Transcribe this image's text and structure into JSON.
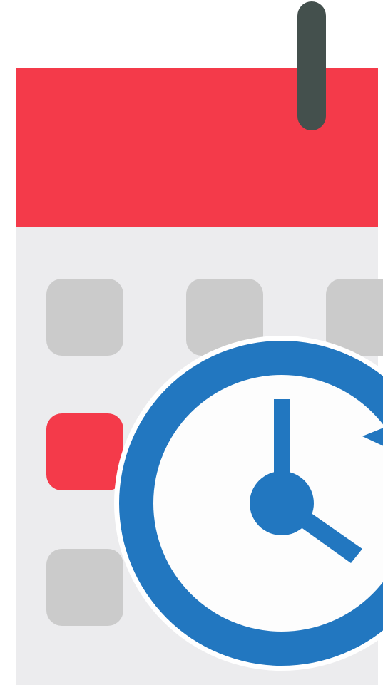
{
  "icon": {
    "subject": "calendar-with-clock",
    "colors": {
      "background": "#ffffff",
      "header": "#f43a4a",
      "body": "#ececee",
      "ring": "#44504d",
      "day_inactive": "#cbcbcb",
      "day_highlight": "#f43a4a",
      "clock_rim": "#2277c0",
      "clock_outline": "#ffffff",
      "clock_face": "#fdfdfd",
      "clock_hands": "#2277c0"
    },
    "day_grid": {
      "rows": 3,
      "highlighted": {
        "row": 2,
        "column": 1
      }
    },
    "icon_names": [
      "calendar-icon",
      "calendar-ring-icon",
      "clock-icon",
      "clock-hand-hour-icon",
      "clock-hand-minute-icon"
    ]
  }
}
